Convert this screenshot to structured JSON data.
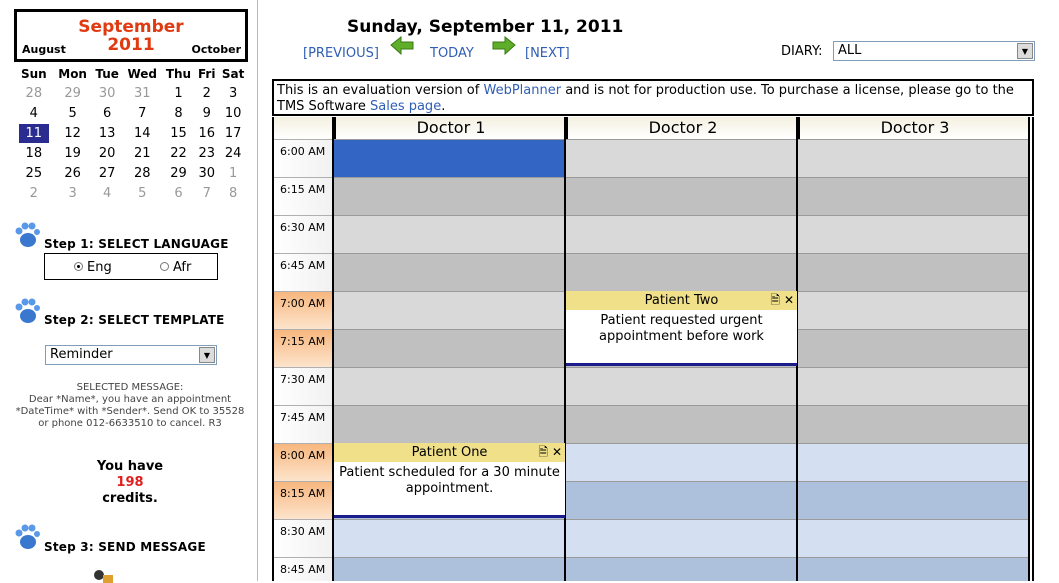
{
  "calendar": {
    "month": "September",
    "year": "2011",
    "prev": "August",
    "next": "October",
    "weekdays": [
      "Sun",
      "Mon",
      "Tue",
      "Wed",
      "Thu",
      "Fri",
      "Sat"
    ],
    "weeks": [
      [
        "28",
        "29",
        "30",
        "31",
        "1",
        "2",
        "3"
      ],
      [
        "4",
        "5",
        "6",
        "7",
        "8",
        "9",
        "10"
      ],
      [
        "11",
        "12",
        "13",
        "14",
        "15",
        "16",
        "17"
      ],
      [
        "18",
        "19",
        "20",
        "21",
        "22",
        "23",
        "24"
      ],
      [
        "25",
        "26",
        "27",
        "28",
        "29",
        "30",
        "1"
      ],
      [
        "2",
        "3",
        "4",
        "5",
        "6",
        "7",
        "8"
      ]
    ]
  },
  "step1": {
    "label": "Step 1: SELECT LANGUAGE",
    "options": [
      "Eng",
      "Afr"
    ],
    "selected": "Eng"
  },
  "step2": {
    "label": "Step 2: SELECT TEMPLATE",
    "value": "Reminder"
  },
  "selected_message": {
    "heading": "SELECTED MESSAGE:",
    "text": "Dear *Name*, you have an appointment *DateTime* with *Sender*. Send OK to 35528 or phone 012-6633510 to cancel. R3"
  },
  "credits": {
    "prefix": "You have",
    "amount": "198",
    "suffix": "credits."
  },
  "step3": {
    "label": "Step 3: SEND MESSAGE"
  },
  "planner": {
    "date_title": "Sunday, September 11, 2011",
    "prev": "[PREVIOUS]",
    "today": "TODAY",
    "next": "[NEXT]",
    "diary_label": "DIARY:",
    "diary_value": "ALL",
    "eval_text_1": "This is an evaluation version of ",
    "eval_link_1": "WebPlanner",
    "eval_text_2": " and is not for production use. To purchase a license, please go to the TMS Software ",
    "eval_link_2": "Sales page",
    "eval_text_3": ".",
    "doctors": [
      "Doctor 1",
      "Doctor 2",
      "Doctor 3"
    ],
    "times": [
      "6:00 AM",
      "6:15 AM",
      "6:30 AM",
      "6:45 AM",
      "7:00 AM",
      "7:15 AM",
      "7:30 AM",
      "7:45 AM",
      "8:00 AM",
      "8:15 AM",
      "8:30 AM",
      "8:45 AM"
    ],
    "appointments": [
      {
        "title": "Patient Two",
        "text": "Patient requested urgent appointment before work"
      },
      {
        "title": "Patient One",
        "text": "Patient scheduled for a 30 minute appointment."
      }
    ]
  },
  "colors": {
    "accent": "#e03a10",
    "link": "#2f5eb5",
    "selected_day": "#2b2c8f",
    "appt_header": "#f0e08a",
    "selected_slot": "#3366c4"
  }
}
